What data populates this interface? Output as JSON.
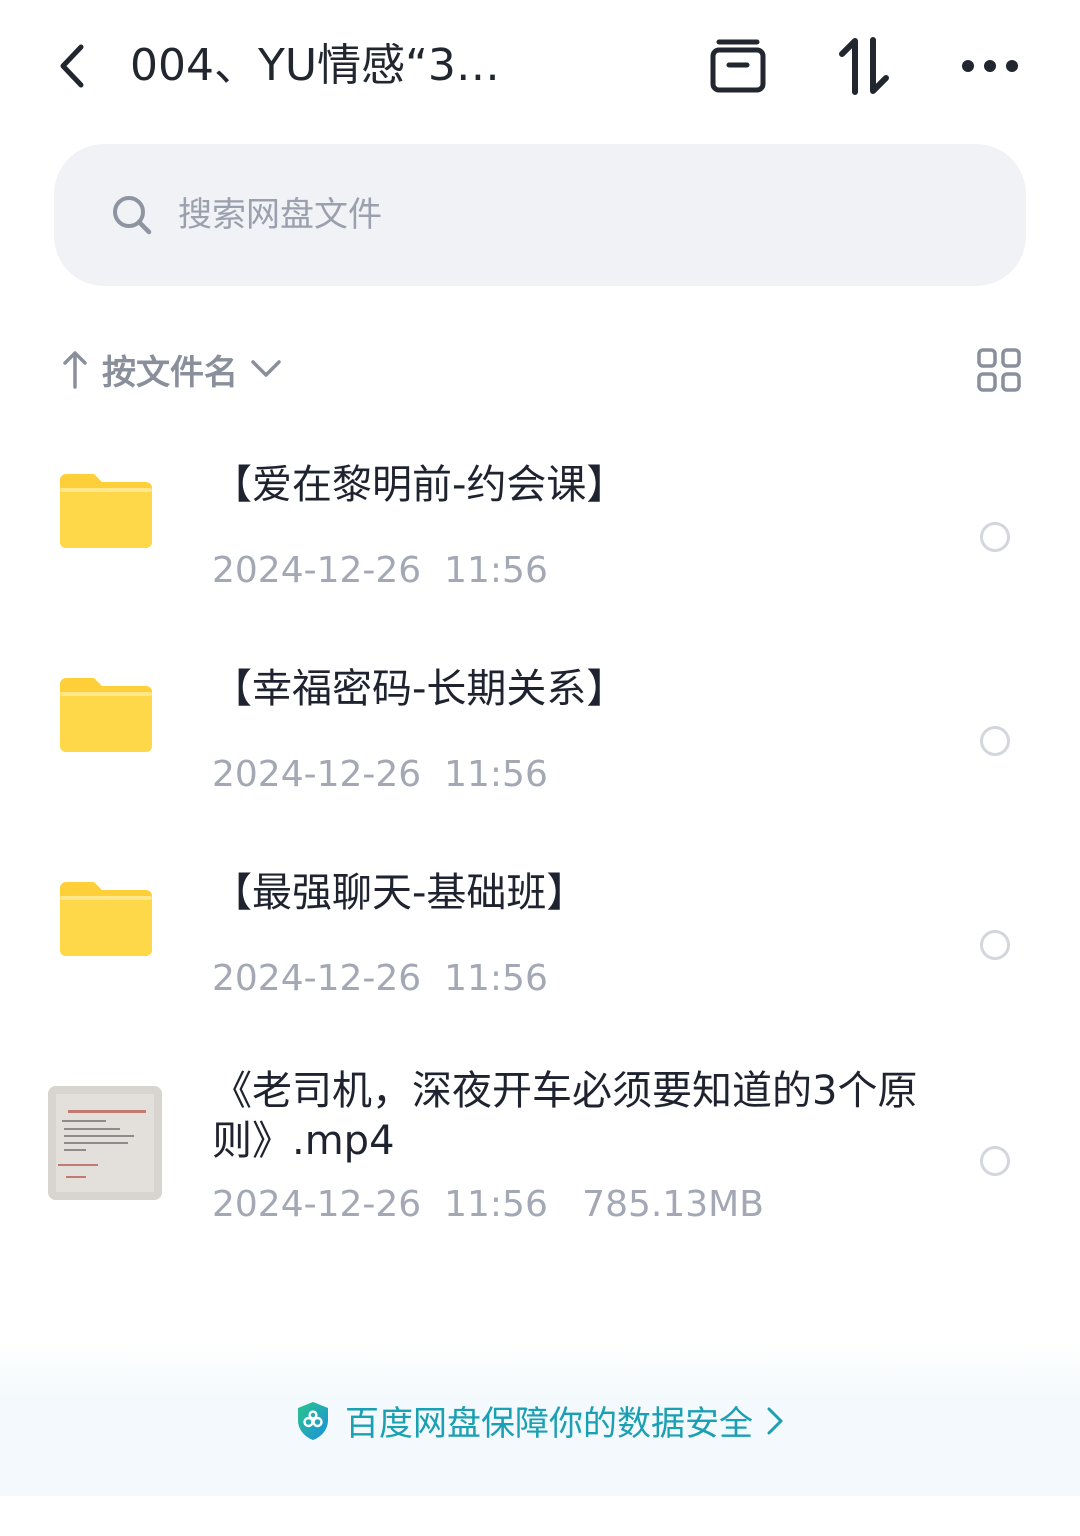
{
  "header": {
    "title": "004、YU情感“3…",
    "icons": [
      "back-icon",
      "archive-icon",
      "sort-icon",
      "more-icon"
    ]
  },
  "search": {
    "placeholder": "搜索网盘文件"
  },
  "sort": {
    "label": "按文件名"
  },
  "files": [
    {
      "type": "folder",
      "name": "【爱在黎明前-约会课】",
      "meta": "2024-12-26  11:56"
    },
    {
      "type": "folder",
      "name": "【幸福密码-长期关系】",
      "meta": "2024-12-26  11:56"
    },
    {
      "type": "folder",
      "name": "【最强聊天-基础班】",
      "meta": "2024-12-26  11:56"
    },
    {
      "type": "video",
      "name": "《老司机，深夜开车必须要知道的3个原则》.mp4",
      "meta": "2024-12-26  11:56   785.13MB"
    }
  ],
  "footer": {
    "text": "百度网盘保障你的数据安全"
  },
  "colors": {
    "folder": "#FFD84A",
    "accent": "#1AA0B3",
    "muted": "#A3A8B4",
    "search_bg": "#F1F2F6"
  }
}
